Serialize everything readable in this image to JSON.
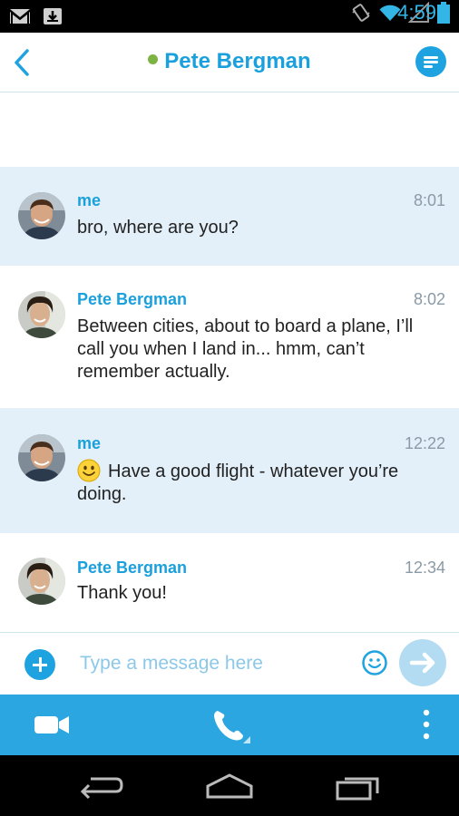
{
  "status_bar": {
    "time": "4:59",
    "icons": [
      "gmail-icon",
      "download-icon",
      "vibrate-icon",
      "wifi-icon",
      "signal-icon",
      "battery-icon"
    ]
  },
  "header": {
    "contact_name": "Pete Bergman",
    "presence": "online",
    "presence_color": "#7cb342"
  },
  "messages": [
    {
      "sender": "me",
      "time": "8:01",
      "text": "bro, where are you?",
      "mine": true
    },
    {
      "sender": "Pete Bergman",
      "time": "8:02",
      "text": "Between cities, about to board a plane, I’ll call you when I land in... hmm, can’t remember actually.",
      "mine": false
    },
    {
      "sender": "me",
      "time": "12:22",
      "text": "Have a good flight - whatever you’re doing.",
      "mine": true,
      "emoji": "smiley-icon"
    },
    {
      "sender": "Pete Bergman",
      "time": "12:34",
      "text": "Thank you!",
      "mine": false
    }
  ],
  "composer": {
    "placeholder": "Type a message here",
    "value": ""
  },
  "colors": {
    "accent": "#1ea3e0",
    "action_bar": "#2ba6e1",
    "mine_bubble": "#e3f0f9",
    "send_disabled": "#b3dcf3"
  }
}
